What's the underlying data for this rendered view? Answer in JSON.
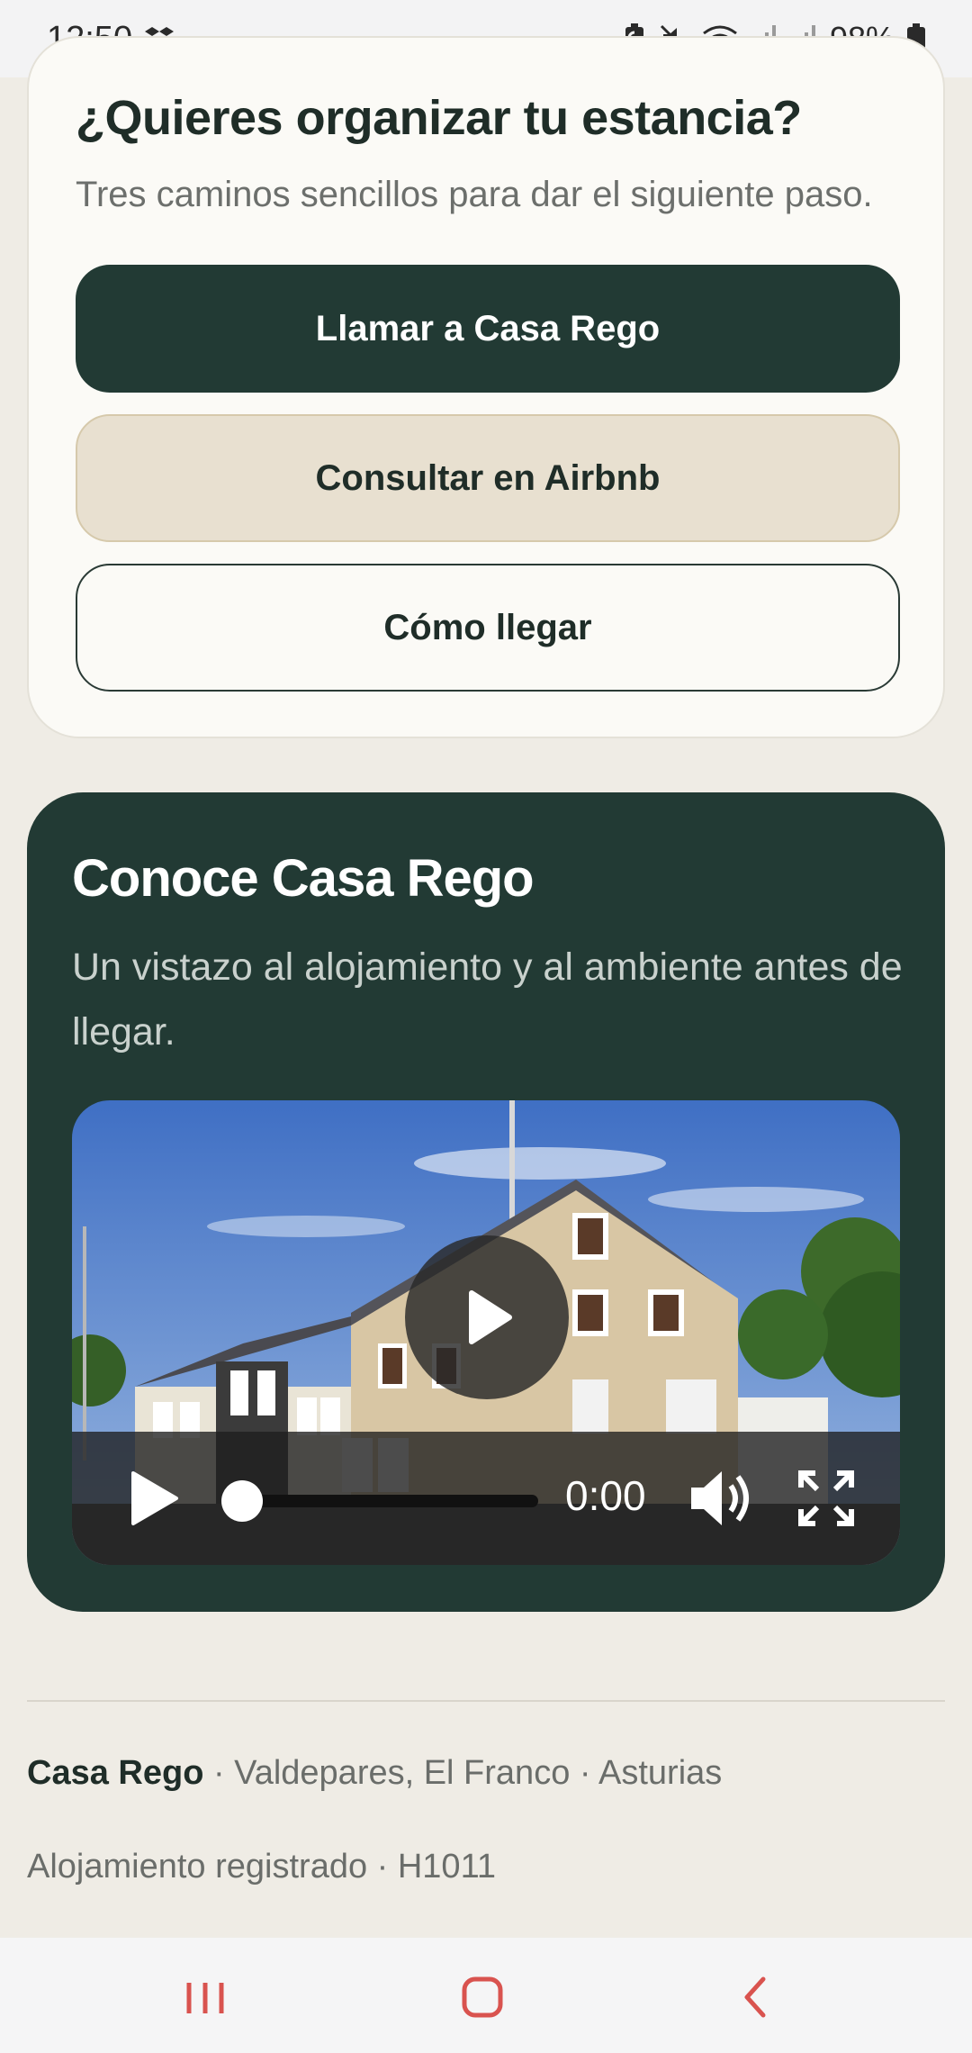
{
  "status_bar": {
    "time": "12:50",
    "battery": "98%",
    "icons": [
      "dropbox-icon",
      "battery-saver-icon",
      "mute-icon",
      "wifi-icon",
      "signal-icon",
      "signal-icon",
      "battery-icon"
    ]
  },
  "plan_card": {
    "title": "¿Quieres organizar tu estancia?",
    "subtitle": "Tres caminos sencillos para dar el siguiente paso.",
    "buttons": {
      "call": "Llamar a Casa Rego",
      "airbnb": "Consultar en Airbnb",
      "route": "Cómo llegar"
    }
  },
  "video_card": {
    "title": "Conoce Casa Rego",
    "description": "Un vistazo al alojamiento y al ambiente antes de llegar.",
    "player": {
      "time": "0:00",
      "progress": 0
    }
  },
  "footer": {
    "name": "Casa Rego",
    "location": " · Valdepares, El Franco · Asturias",
    "registration": "Alojamiento registrado · H1011"
  },
  "colors": {
    "page_bg": "#efece5",
    "dark_green": "#223a34",
    "sand": "#e8e0d0",
    "nav_accent": "#d9534f"
  }
}
